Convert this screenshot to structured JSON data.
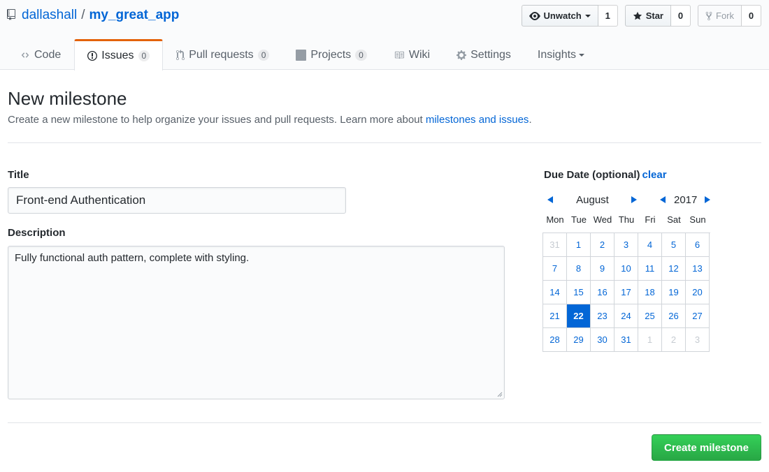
{
  "repo": {
    "owner": "dallashall",
    "separator": "/",
    "name": "my_great_app"
  },
  "actions": {
    "watch": {
      "label": "Unwatch",
      "count": "1"
    },
    "star": {
      "label": "Star",
      "count": "0"
    },
    "fork": {
      "label": "Fork",
      "count": "0"
    }
  },
  "tabs": [
    {
      "label": "Code",
      "icon": "code-icon"
    },
    {
      "label": "Issues",
      "counter": "0",
      "icon": "issue-icon",
      "selected": true
    },
    {
      "label": "Pull requests",
      "counter": "0",
      "icon": "pull-request-icon"
    },
    {
      "label": "Projects",
      "counter": "0",
      "icon": "project-icon"
    },
    {
      "label": "Wiki",
      "icon": "book-icon"
    },
    {
      "label": "Settings",
      "icon": "gear-icon"
    },
    {
      "label": "Insights",
      "icon": "dropdown-caret"
    }
  ],
  "page": {
    "title": "New milestone",
    "description": "Create a new milestone to help organize your issues and pull requests. Learn more about ",
    "description_link": "milestones and issues",
    "description_end": "."
  },
  "form": {
    "title_label": "Title",
    "title_value": "Front-end Authentication",
    "description_label": "Description",
    "description_value": "Fully functional auth pattern, complete with styling."
  },
  "due_date": {
    "label": "Due Date (optional)",
    "clear_label": "clear",
    "month": "August",
    "year": "2017",
    "weekdays": [
      "Mon",
      "Tue",
      "Wed",
      "Thu",
      "Fri",
      "Sat",
      "Sun"
    ],
    "days": [
      {
        "d": "31",
        "other": true
      },
      {
        "d": "1"
      },
      {
        "d": "2"
      },
      {
        "d": "3"
      },
      {
        "d": "4"
      },
      {
        "d": "5"
      },
      {
        "d": "6"
      },
      {
        "d": "7"
      },
      {
        "d": "8"
      },
      {
        "d": "9"
      },
      {
        "d": "10"
      },
      {
        "d": "11"
      },
      {
        "d": "12"
      },
      {
        "d": "13"
      },
      {
        "d": "14"
      },
      {
        "d": "15"
      },
      {
        "d": "16"
      },
      {
        "d": "17"
      },
      {
        "d": "18"
      },
      {
        "d": "19"
      },
      {
        "d": "20"
      },
      {
        "d": "21"
      },
      {
        "d": "22",
        "selected": true
      },
      {
        "d": "23"
      },
      {
        "d": "24"
      },
      {
        "d": "25"
      },
      {
        "d": "26"
      },
      {
        "d": "27"
      },
      {
        "d": "28"
      },
      {
        "d": "29"
      },
      {
        "d": "30"
      },
      {
        "d": "31"
      },
      {
        "d": "1",
        "other": true
      },
      {
        "d": "2",
        "other": true
      },
      {
        "d": "3",
        "other": true
      }
    ]
  },
  "submit_label": "Create milestone",
  "colors": {
    "link": "#0366d6",
    "accent_tab": "#e36209",
    "primary_button": "#28a745"
  }
}
